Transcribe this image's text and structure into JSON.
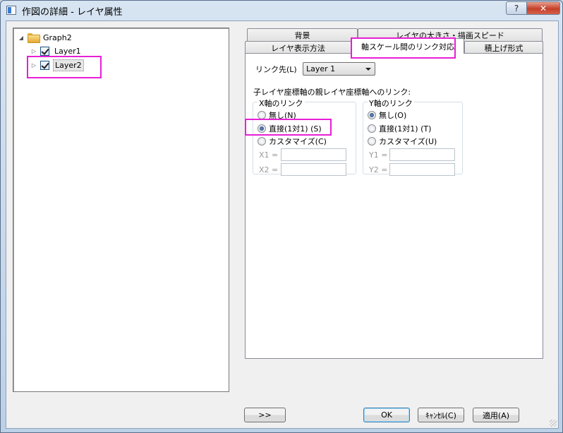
{
  "window": {
    "title": "作図の詳細 - レイヤ属性",
    "help_label": "?",
    "close_label": "✕"
  },
  "tree": {
    "root": {
      "label": "Graph2",
      "icon": "folder-icon"
    },
    "items": [
      {
        "label": "Layer1",
        "checked": true
      },
      {
        "label": "Layer2",
        "checked": true,
        "selected": true
      }
    ]
  },
  "tabs": {
    "row_back": [
      "背景",
      "レイヤの大きさ・描画スピード"
    ],
    "row_front": [
      "レイヤ表示方法",
      "軸スケール間のリンク対応",
      "積上げ形式"
    ],
    "active": "軸スケール間のリンク対応"
  },
  "link_panel": {
    "link_to_label": "リンク先(L)",
    "link_to_value": "Layer 1",
    "section_title": "子レイヤ座標軸の親レイヤ座標軸へのリンク:",
    "x_group": {
      "title": "X軸のリンク",
      "options": [
        "無し(N)",
        "直接(1対1) (S)",
        "カスタマイズ(C)"
      ],
      "selected": "直接(1対1) (S)",
      "field1_label": "X1 =",
      "field2_label": "X2 ="
    },
    "y_group": {
      "title": "Y軸のリンク",
      "options": [
        "無し(O)",
        "直接(1対1) (T)",
        "カスタマイズ(U)"
      ],
      "selected": "無し(O)",
      "field1_label": "Y1 =",
      "field2_label": "Y2 ="
    }
  },
  "buttons": {
    "expand": ">>",
    "ok": "OK",
    "cancel": "ｷｬﾝｾﾙ(C)",
    "apply": "適用(A)"
  },
  "colors": {
    "highlight": "#e81fd6"
  }
}
